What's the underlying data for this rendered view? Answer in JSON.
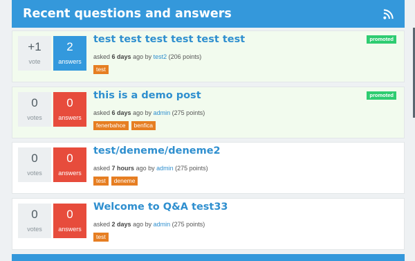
{
  "header": {
    "title": "Recent questions and answers",
    "feed_icon": "rss-icon"
  },
  "questions": [
    {
      "votes": "+1",
      "votes_label": "vote",
      "answers": "2",
      "answers_label": "answers",
      "answers_color": "#3399dd",
      "title": "test test test test test test",
      "asked": "asked",
      "when": "6 days",
      "ago_by": "ago by",
      "user": "test2",
      "points": "(206 points)",
      "tags": [
        "test"
      ],
      "badge": "promoted"
    },
    {
      "votes": "0",
      "votes_label": "votes",
      "answers": "0",
      "answers_label": "answers",
      "answers_color": "#e74c3c",
      "title": "this is a demo post",
      "asked": "asked",
      "when": "6 days",
      "ago_by": "ago by",
      "user": "admin",
      "points": "(275 points)",
      "tags": [
        "fenerbahce",
        "benfica"
      ],
      "badge": "promoted"
    },
    {
      "votes": "0",
      "votes_label": "votes",
      "answers": "0",
      "answers_label": "answers",
      "answers_color": "#e74c3c",
      "title": "test/deneme/deneme2",
      "asked": "asked",
      "when": "7 hours",
      "ago_by": "ago by",
      "user": "admin",
      "points": "(275 points)",
      "tags": [
        "test",
        "deneme"
      ]
    },
    {
      "votes": "0",
      "votes_label": "votes",
      "answers": "0",
      "answers_label": "answers",
      "answers_color": "#e74c3c",
      "title": "Welcome to Q&A test33",
      "asked": "asked",
      "when": "2 days",
      "ago_by": "ago by",
      "user": "admin",
      "points": "(275 points)",
      "tags": [
        "test"
      ]
    }
  ]
}
